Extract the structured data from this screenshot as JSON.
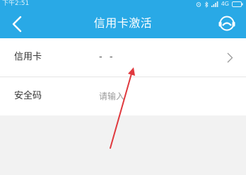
{
  "status_bar": {
    "time": "下午2:51",
    "network": "4G",
    "icons": [
      "alarm-icon",
      "bluetooth-icon",
      "signal-icon",
      "battery-icon"
    ]
  },
  "header": {
    "title": "信用卡激活",
    "back_icon": "back-chevron-icon",
    "service_icon": "customer-service-icon"
  },
  "form": {
    "rows": [
      {
        "label": "信用卡",
        "value": "- -"
      },
      {
        "label": "安全码",
        "placeholder": "请输入"
      }
    ]
  },
  "annotation": {
    "color": "#e0393e"
  },
  "colors": {
    "accent": "#29a9e6",
    "background": "#f2f2f2",
    "divider": "#e6e6e6"
  }
}
